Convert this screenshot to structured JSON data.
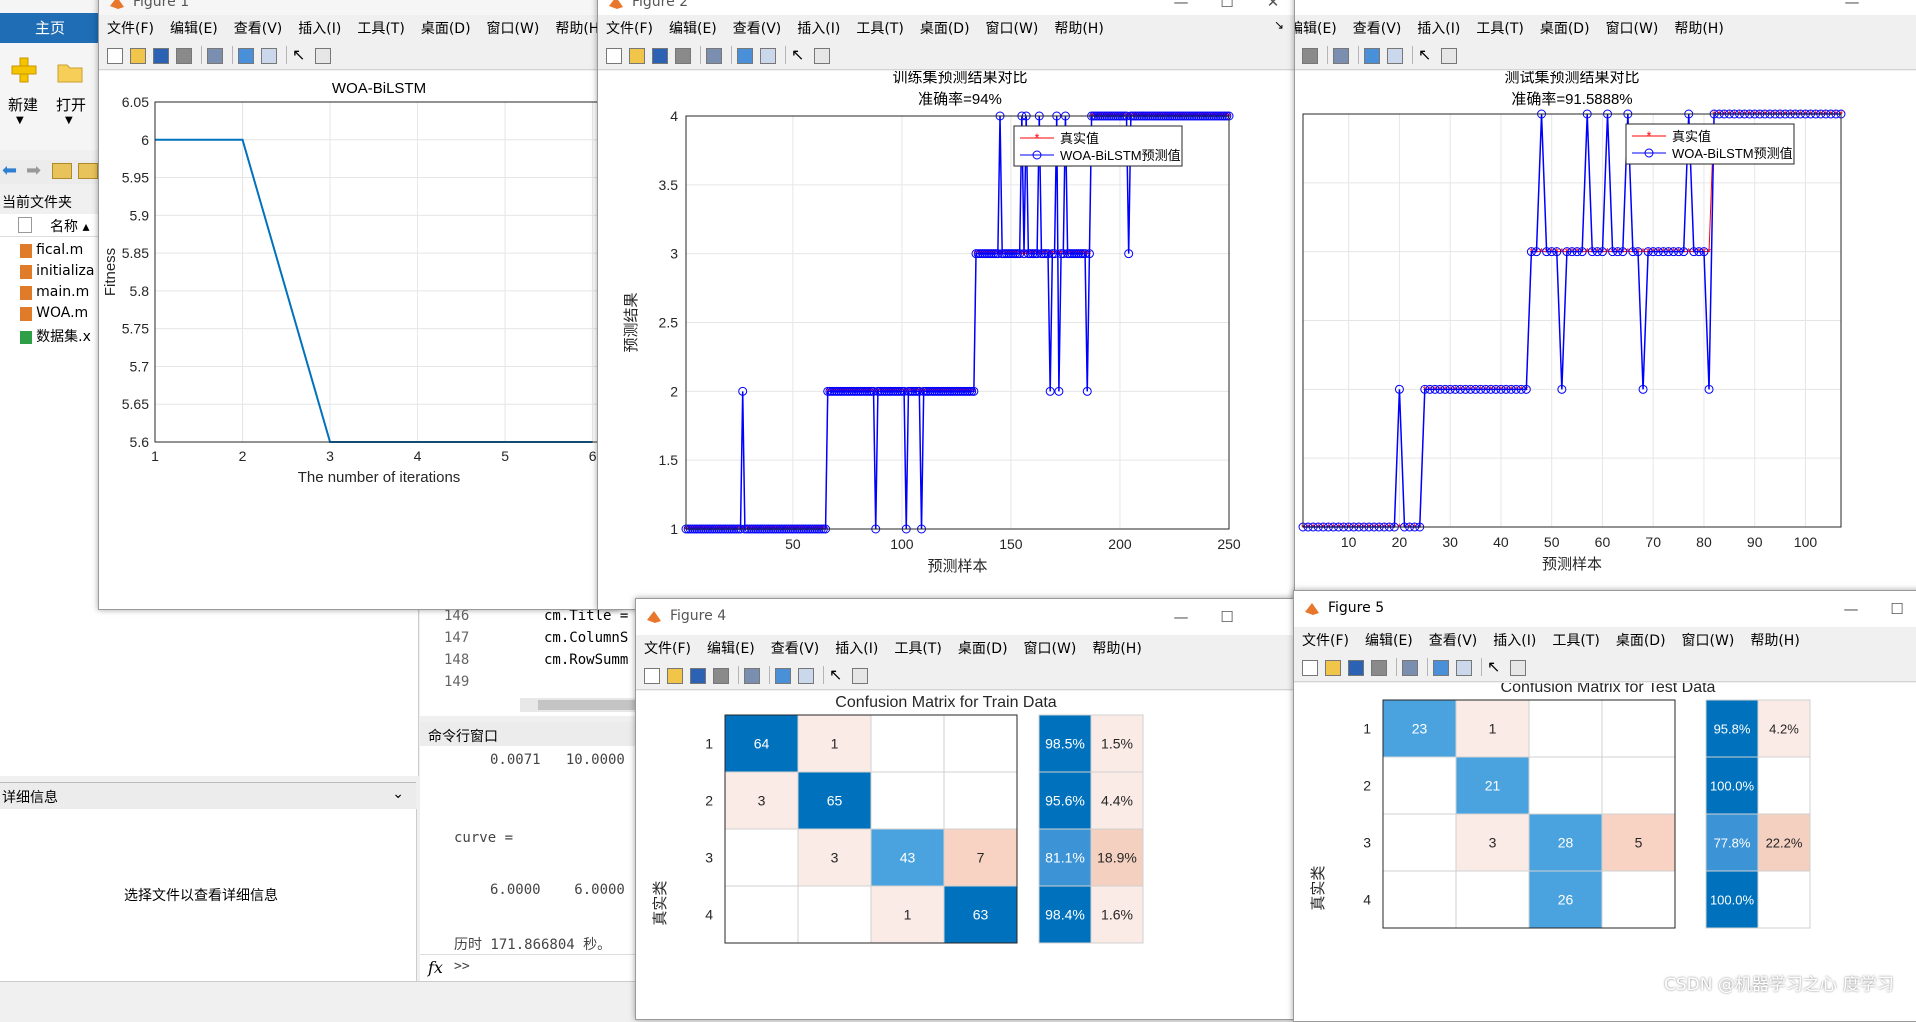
{
  "desktop": {
    "home_tab": "主页",
    "new_label": "新建",
    "open_label": "打开",
    "current_folder_label": "当前文件夹",
    "name_column": "名称 ▴",
    "files": [
      "fical.m",
      "initializa",
      "main.m",
      "WOA.m",
      "数据集.x"
    ],
    "details_label": "详细信息",
    "details_hint": "选择文件以查看详细信息",
    "editor_line_numbers": [
      "146",
      "147",
      "148",
      "149"
    ],
    "editor_lines": [
      "cm.Title =",
      "cm.ColumnS",
      "cm.RowSumm",
      ""
    ],
    "command_window_title": "命令行窗口",
    "cmd_lines": [
      "0.0071   10.0000",
      "curve =",
      "6.0000    6.0000",
      "历时 171.866804 秒。"
    ],
    "fx_label": "fx",
    "prompt": ">>",
    "watermark": "CSDN @机器学习之心",
    "watermark_tail": "度学习"
  },
  "menus": {
    "file": "文件(F)",
    "edit": "编辑(E)",
    "view": "查看(V)",
    "insert": "插入(I)",
    "tools": "工具(T)",
    "desktop": "桌面(D)",
    "window": "窗口(W)",
    "help": "帮助(H)"
  },
  "figures": {
    "fig1_title": "Figure 1",
    "fig2_title": "Figure 2",
    "fig4_title": "Figure 4",
    "fig5_title": "Figure 5"
  },
  "chart_data": [
    {
      "id": "fitness",
      "type": "line",
      "title": "WOA-BiLSTM",
      "xlabel": "The number of iterations",
      "ylabel": "Fitness",
      "x": [
        1,
        2,
        3,
        4,
        5,
        6
      ],
      "y": [
        6.0,
        6.0,
        5.6,
        5.6,
        5.6,
        5.6
      ],
      "xticks": [
        "1",
        "2",
        "3",
        "4",
        "5",
        "6"
      ],
      "yticks": [
        "6.05",
        "6",
        "5.95",
        "5.9",
        "5.85",
        "5.8",
        "5.75",
        "5.7",
        "5.65",
        "5.6"
      ],
      "ylim": [
        5.6,
        6.05
      ],
      "grid": true,
      "color": "#0072bd"
    },
    {
      "id": "train",
      "type": "line",
      "title": "训练集预测结果对比",
      "subtitle": "准确率=94%",
      "xlabel": "预测样本",
      "ylabel": "预测结果",
      "xticks": [
        "50",
        "100",
        "150",
        "200",
        "250"
      ],
      "yticks": [
        "1",
        "1.5",
        "2",
        "2.5",
        "3",
        "3.5",
        "4"
      ],
      "xlim": [
        1,
        250
      ],
      "ylim": [
        1,
        4
      ],
      "legend": [
        "真实值",
        "WOA-BiLSTM预测值"
      ],
      "legend_position": "top-right",
      "true_segments": [
        [
          1,
          65,
          1
        ],
        [
          66,
          133,
          2
        ],
        [
          134,
          186,
          3
        ],
        [
          187,
          250,
          4
        ]
      ],
      "pred_outliers": [
        [
          27,
          2
        ],
        [
          88,
          1
        ],
        [
          102,
          1
        ],
        [
          109,
          1
        ],
        [
          145,
          4
        ],
        [
          155,
          4
        ],
        [
          157,
          4
        ],
        [
          163,
          4
        ],
        [
          168,
          2
        ],
        [
          171,
          4
        ],
        [
          172,
          2
        ],
        [
          175,
          4
        ],
        [
          185,
          2
        ],
        [
          204,
          3
        ]
      ],
      "series_colors": {
        "true": "#ff0000",
        "pred": "#0000ff"
      },
      "grid": true
    },
    {
      "id": "test",
      "type": "line",
      "title": "测试集预测结果对比",
      "subtitle": "准确率=91.5888%",
      "xlabel": "预测样本",
      "ylabel": "",
      "xticks": [
        "10",
        "20",
        "30",
        "40",
        "50",
        "60",
        "70",
        "80",
        "90",
        "100"
      ],
      "yticks": [],
      "xlim": [
        1,
        107
      ],
      "ylim": [
        1,
        4
      ],
      "legend": [
        "真实值",
        "WOA-BiLSTM预测值"
      ],
      "legend_position": "top-right",
      "true_segments": [
        [
          1,
          24,
          1
        ],
        [
          25,
          45,
          2
        ],
        [
          46,
          81,
          3
        ],
        [
          82,
          107,
          4
        ]
      ],
      "pred_outliers": [
        [
          20,
          2
        ],
        [
          48,
          4
        ],
        [
          52,
          2
        ],
        [
          57,
          4
        ],
        [
          61,
          4
        ],
        [
          65,
          4
        ],
        [
          68,
          2
        ],
        [
          77,
          4
        ],
        [
          81,
          2
        ]
      ],
      "series_colors": {
        "true": "#ff0000",
        "pred": "#0000ff"
      },
      "grid": true
    },
    {
      "id": "cm_train",
      "type": "heatmap",
      "title": "Confusion Matrix for Train Data",
      "ylabel": "真实类",
      "row_labels": [
        "1",
        "2",
        "3",
        "4"
      ],
      "matrix": [
        [
          64,
          1,
          null,
          null
        ],
        [
          3,
          65,
          null,
          null
        ],
        [
          null,
          3,
          43,
          7
        ],
        [
          null,
          null,
          1,
          63
        ]
      ],
      "row_summary": [
        [
          "98.5%",
          "1.5%"
        ],
        [
          "95.6%",
          "4.4%"
        ],
        [
          "81.1%",
          "18.9%"
        ],
        [
          "98.4%",
          "1.6%"
        ]
      ]
    },
    {
      "id": "cm_test",
      "type": "heatmap",
      "title": "Confusion Matrix for Test Data",
      "ylabel": "真实类",
      "row_labels": [
        "1",
        "2",
        "3",
        "4"
      ],
      "matrix": [
        [
          23,
          1,
          null,
          null
        ],
        [
          null,
          21,
          null,
          null
        ],
        [
          null,
          3,
          28,
          5
        ],
        [
          null,
          null,
          26,
          null
        ]
      ],
      "row_summary": [
        [
          "95.8%",
          "4.2%"
        ],
        [
          "100.0%",
          ""
        ],
        [
          "77.8%",
          "22.2%"
        ],
        [
          "100.0%",
          ""
        ]
      ]
    }
  ]
}
